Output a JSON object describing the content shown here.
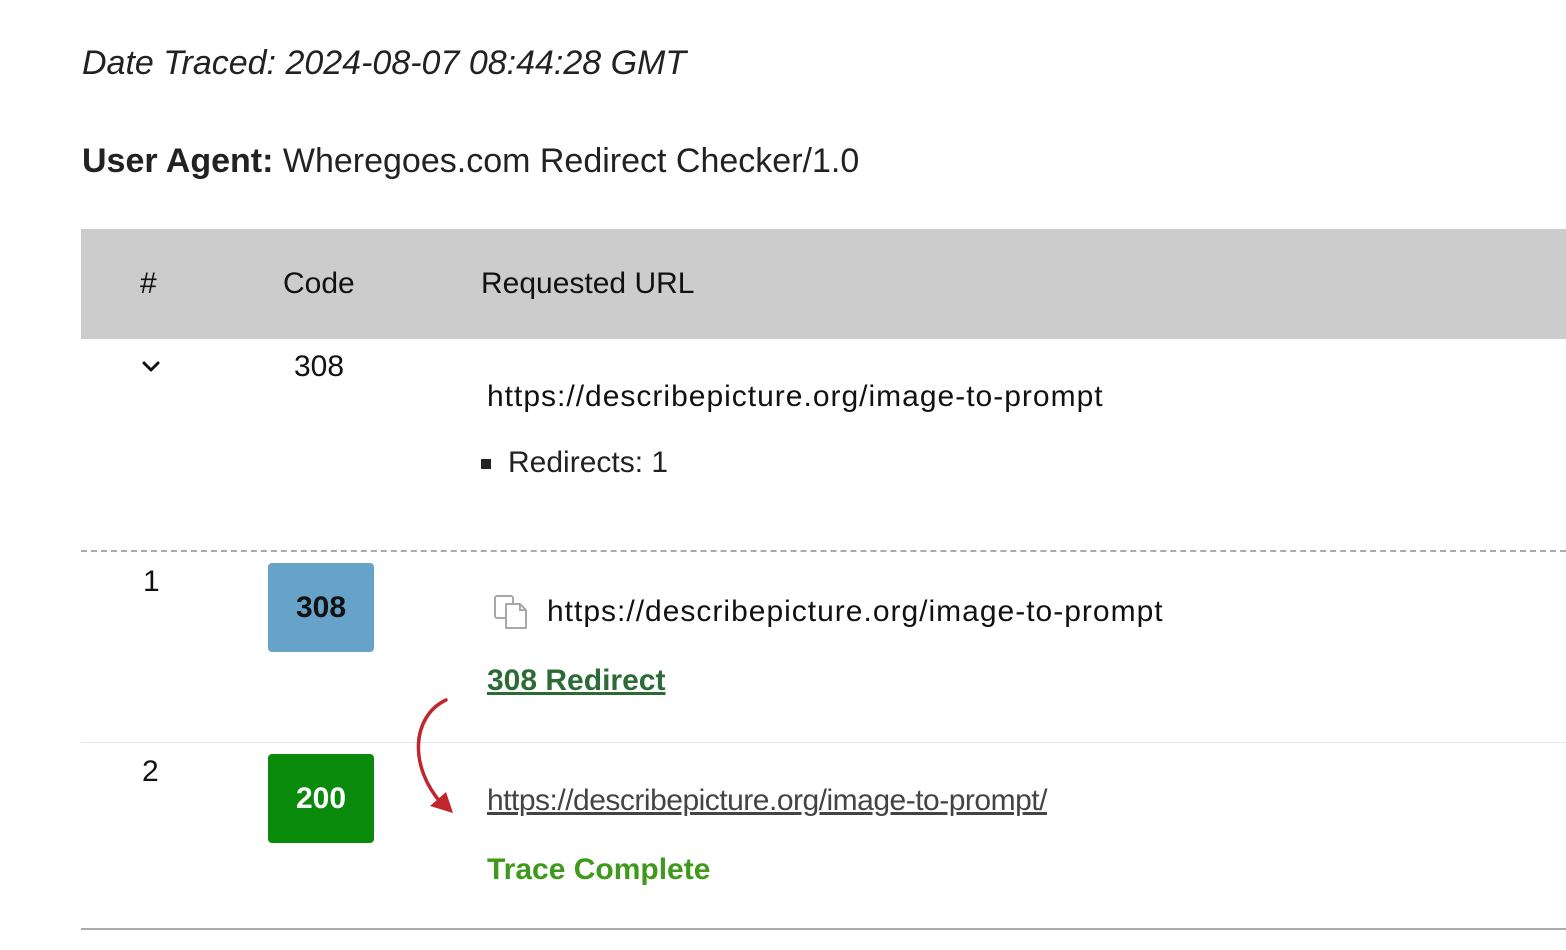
{
  "date_traced": "Date Traced: 2024-08-07 08:44:28 GMT",
  "user_agent": {
    "label": "User Agent:",
    "value": " Wheregoes.com Redirect Checker/1.0"
  },
  "table": {
    "headers": {
      "num": "#",
      "code": "Code",
      "url": "Requested URL"
    },
    "summary": {
      "code": "308",
      "url": "https://describepicture.org/image-to-prompt",
      "redirects": "Redirects: 1"
    },
    "rows": [
      {
        "num": "1",
        "code": "308",
        "url": "https://describepicture.org/image-to-prompt",
        "status_link": "308 Redirect",
        "badge_color": "#67a3c8"
      },
      {
        "num": "2",
        "code": "200",
        "url": "https://describepicture.org/image-to-prompt/",
        "status": "Trace Complete",
        "badge_color": "#098a0b"
      }
    ]
  },
  "icons": {
    "expand": "chevron-down-icon",
    "copy": "copy-icon",
    "arrow": "redirect-arrow-icon"
  },
  "colors": {
    "header_bg": "#cccccc",
    "redirect_link": "#2d6b36",
    "trace_complete": "#3f9a1c",
    "arrow": "#c0272d"
  }
}
